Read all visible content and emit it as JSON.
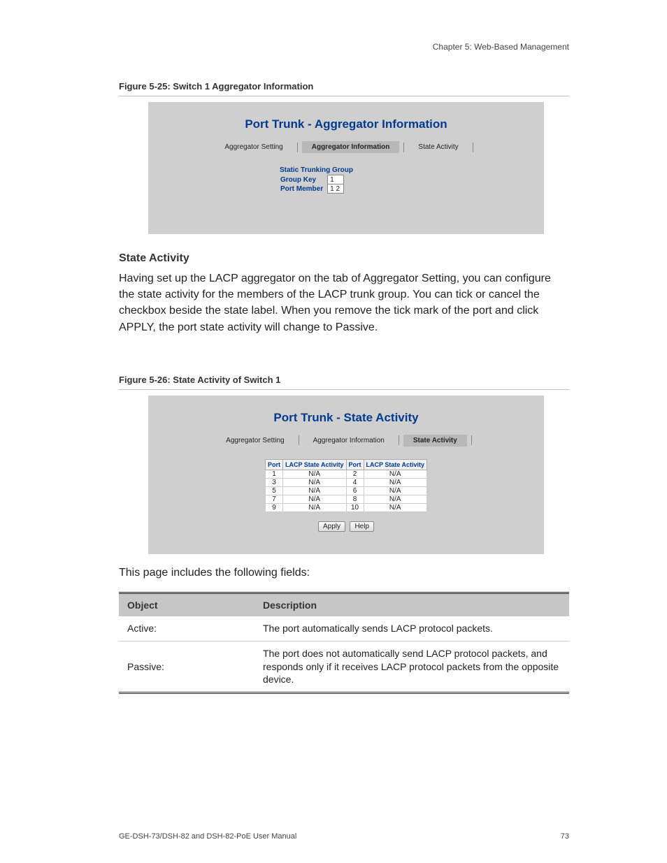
{
  "header": {
    "chapter": "Chapter 5: Web-Based Management"
  },
  "figure1": {
    "caption": "Figure 5-25:  Switch 1 Aggregator Information",
    "title": "Port Trunk - Aggregator Information",
    "tabs": {
      "t1": "Aggregator Setting",
      "t2": "Aggregator Information",
      "t3": "State Activity"
    },
    "info_head": "Static Trunking Group",
    "rows": {
      "r1_label": "Group Key",
      "r1_val": "1",
      "r2_label": "Port Member",
      "r2_val": "1 2"
    }
  },
  "section": {
    "heading": "State Activity",
    "para": "Having set up the LACP aggregator on the tab of Aggregator Setting, you can configure the state activity for the members of the LACP trunk group. You can tick or cancel the checkbox beside the state label. When you remove the tick mark of the port and click APPLY, the port state activity will change to Passive."
  },
  "figure2": {
    "caption": "Figure 5-26:  State Activity of Switch 1",
    "title": "Port Trunk - State Activity",
    "tabs": {
      "t1": "Aggregator Setting",
      "t2": "Aggregator Information",
      "t3": "State Activity"
    },
    "table_head": {
      "h1": "Port",
      "h2": "LACP State Activity",
      "h3": "Port",
      "h4": "LACP State Activity"
    },
    "rows": [
      {
        "p1": "1",
        "s1": "N/A",
        "p2": "2",
        "s2": "N/A"
      },
      {
        "p1": "3",
        "s1": "N/A",
        "p2": "4",
        "s2": "N/A"
      },
      {
        "p1": "5",
        "s1": "N/A",
        "p2": "6",
        "s2": "N/A"
      },
      {
        "p1": "7",
        "s1": "N/A",
        "p2": "8",
        "s2": "N/A"
      },
      {
        "p1": "9",
        "s1": "N/A",
        "p2": "10",
        "s2": "N/A"
      }
    ],
    "buttons": {
      "apply": "Apply",
      "help": "Help"
    }
  },
  "fields_intro": "This page includes the following fields:",
  "obj_table": {
    "head": {
      "c1": "Object",
      "c2": "Description"
    },
    "rows": [
      {
        "obj": "Active:",
        "desc": "The port automatically sends LACP protocol packets."
      },
      {
        "obj": "Passive:",
        "desc": "The port does not automatically send LACP protocol packets, and responds only if it receives LACP protocol packets from the opposite device."
      }
    ]
  },
  "footer": {
    "left": "GE-DSH-73/DSH-82 and DSH-82-PoE User Manual",
    "right": "73"
  }
}
